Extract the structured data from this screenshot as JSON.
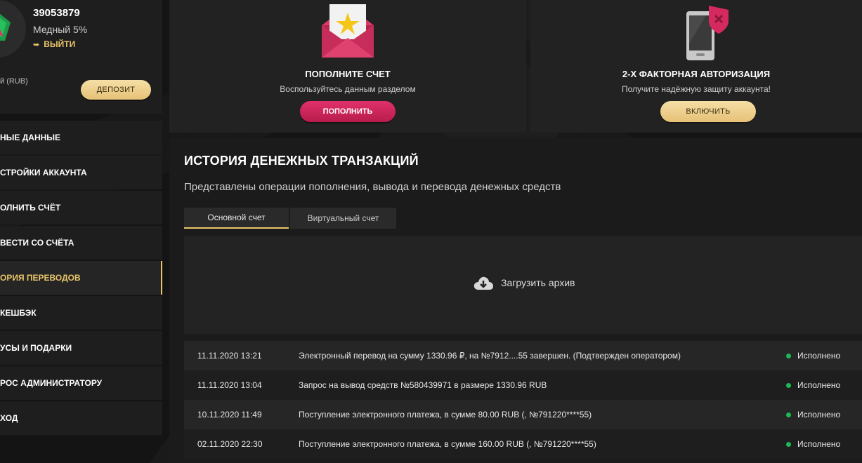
{
  "profile": {
    "user_id": "39053879",
    "level": "Медный 5%",
    "logout_label": "ВЫЙТИ",
    "balance_label": "й (RUB)",
    "deposit_label": "ДЕПОЗИТ"
  },
  "menu": [
    {
      "label": "НЫЕ ДАННЫЕ",
      "active": false
    },
    {
      "label": "СТРОЙКИ АККАУНТА",
      "active": false
    },
    {
      "label": "ОЛНИТЬ СЧЁТ",
      "active": false
    },
    {
      "label": "ВЕСТИ СО СЧЁТА",
      "active": false
    },
    {
      "label": "ОРИЯ ПЕРЕВОДОВ",
      "active": true
    },
    {
      "label": "КЕШБЭК",
      "active": false
    },
    {
      "label": "УСЫ И ПОДАРКИ",
      "active": false
    },
    {
      "label": "РОС АДМИНИСТРАТОРУ",
      "active": false
    },
    {
      "label": "ХОД",
      "active": false
    }
  ],
  "cards": {
    "topup": {
      "icon": "envelope-star-icon",
      "title": "ПОПОЛНИТЕ СЧЕТ",
      "subtitle": "Воспользуйтесь данным разделом",
      "button": "ПОПОЛНИТЬ"
    },
    "twofa": {
      "icon": "phone-shield-icon",
      "title": "2-Х ФАКТОРНАЯ АВТОРИЗАЦИЯ",
      "subtitle": "Получите надёжную защиту аккаунта!",
      "button": "ВКЛЮЧИТЬ"
    }
  },
  "history": {
    "title": "ИСТОРИЯ ДЕНЕЖНЫХ ТРАНЗАКЦИЙ",
    "subtitle": "Представлены операции пополнения, вывода и перевода денежных средств",
    "tabs": [
      {
        "label": "Основной счет",
        "active": true
      },
      {
        "label": "Виртуальный счет",
        "active": false
      }
    ],
    "archive_label": "Загрузить архив",
    "rows": [
      {
        "date": "11.11.2020 13:21",
        "description": "Электронный перевод на сумму 1330.96 ₽, на №7912....55 завершен. (Подтвержден оператором)",
        "status": "Исполнено"
      },
      {
        "date": "11.11.2020 13:04",
        "description": "Запрос на вывод средств №580439971 в размере 1330.96 RUB",
        "status": "Исполнено"
      },
      {
        "date": "10.11.2020 11:49",
        "description": "Поступление электронного платежа, в сумме 80.00 RUB (, №791220****55)",
        "status": "Исполнено"
      },
      {
        "date": "02.11.2020 22:30",
        "description": "Поступление электронного платежа, в сумме 160.00 RUB (, №791220****55)",
        "status": "Исполнено"
      }
    ]
  },
  "colors": {
    "accent_gold": "#e9c46a",
    "accent_red": "#d42a5f",
    "status_green": "#1db954"
  }
}
